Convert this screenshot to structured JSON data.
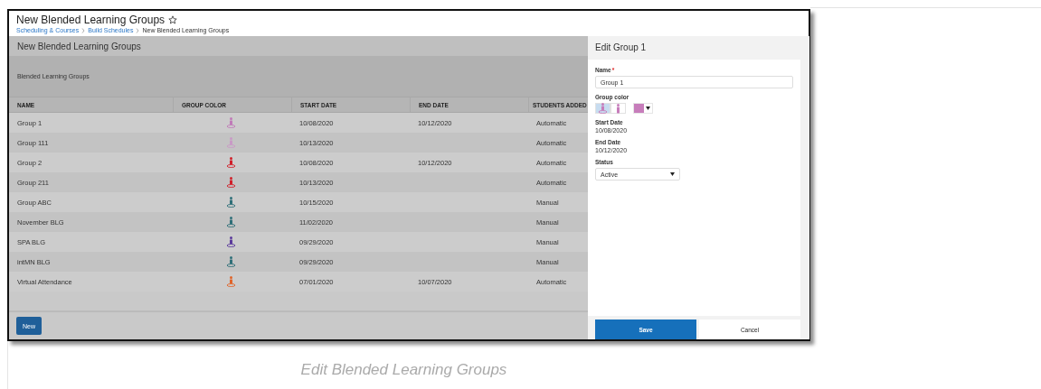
{
  "page": {
    "title": "New Blended Learning Groups",
    "breadcrumb": [
      {
        "label": "Scheduling & Courses",
        "link": true
      },
      {
        "label": "Build Schedules",
        "link": true
      },
      {
        "label": "New Blended Learning Groups",
        "link": false
      }
    ]
  },
  "list_panel": {
    "heading": "New Blended Learning Groups",
    "section": "Blended Learning Groups",
    "columns": [
      "NAME",
      "GROUP COLOR",
      "START DATE",
      "END DATE",
      "STUDENTS ADDED"
    ],
    "rows": [
      {
        "name": "Group 1",
        "color": "#c07ab8",
        "start_date": "10/08/2020",
        "end_date": "10/12/2020",
        "students_added": "Automatic"
      },
      {
        "name": "Group 111",
        "color": "#c99ac6",
        "start_date": "10/13/2020",
        "end_date": "",
        "students_added": "Automatic"
      },
      {
        "name": "Group 2",
        "color": "#d0202a",
        "start_date": "10/08/2020",
        "end_date": "10/12/2020",
        "students_added": "Automatic"
      },
      {
        "name": "Group 211",
        "color": "#d0202a",
        "start_date": "10/13/2020",
        "end_date": "",
        "students_added": "Automatic"
      },
      {
        "name": "Group ABC",
        "color": "#2f6f78",
        "start_date": "10/15/2020",
        "end_date": "",
        "students_added": "Manual"
      },
      {
        "name": "November BLG",
        "color": "#2f6f78",
        "start_date": "11/02/2020",
        "end_date": "",
        "students_added": "Manual"
      },
      {
        "name": "SPA BLG",
        "color": "#5b3a9c",
        "start_date": "09/29/2020",
        "end_date": "",
        "students_added": "Manual"
      },
      {
        "name": "intMN BLG",
        "color": "#2f6f78",
        "start_date": "09/29/2020",
        "end_date": "",
        "students_added": "Manual"
      },
      {
        "name": "Virtual Attendance",
        "color": "#e0642a",
        "start_date": "07/01/2020",
        "end_date": "10/07/2020",
        "students_added": "Automatic"
      }
    ],
    "new_button": "New"
  },
  "edit_panel": {
    "heading": "Edit Group 1",
    "name": {
      "label": "Name",
      "required_mark": "*",
      "value": "Group 1"
    },
    "group_color": {
      "label": "Group color",
      "icon_options": [
        {
          "kind": "ring-person",
          "selected": true
        },
        {
          "kind": "person",
          "selected": false
        }
      ],
      "color": "#c77dbb"
    },
    "start_date": {
      "label": "Start Date",
      "value": "10/08/2020"
    },
    "end_date": {
      "label": "End Date",
      "value": "10/12/2020"
    },
    "status": {
      "label": "Status",
      "value": "Active"
    },
    "buttons": [
      {
        "label": "Save",
        "kind": "primary"
      },
      {
        "label": "Cancel",
        "kind": "secondary"
      }
    ]
  },
  "caption": "Edit Blended Learning Groups"
}
